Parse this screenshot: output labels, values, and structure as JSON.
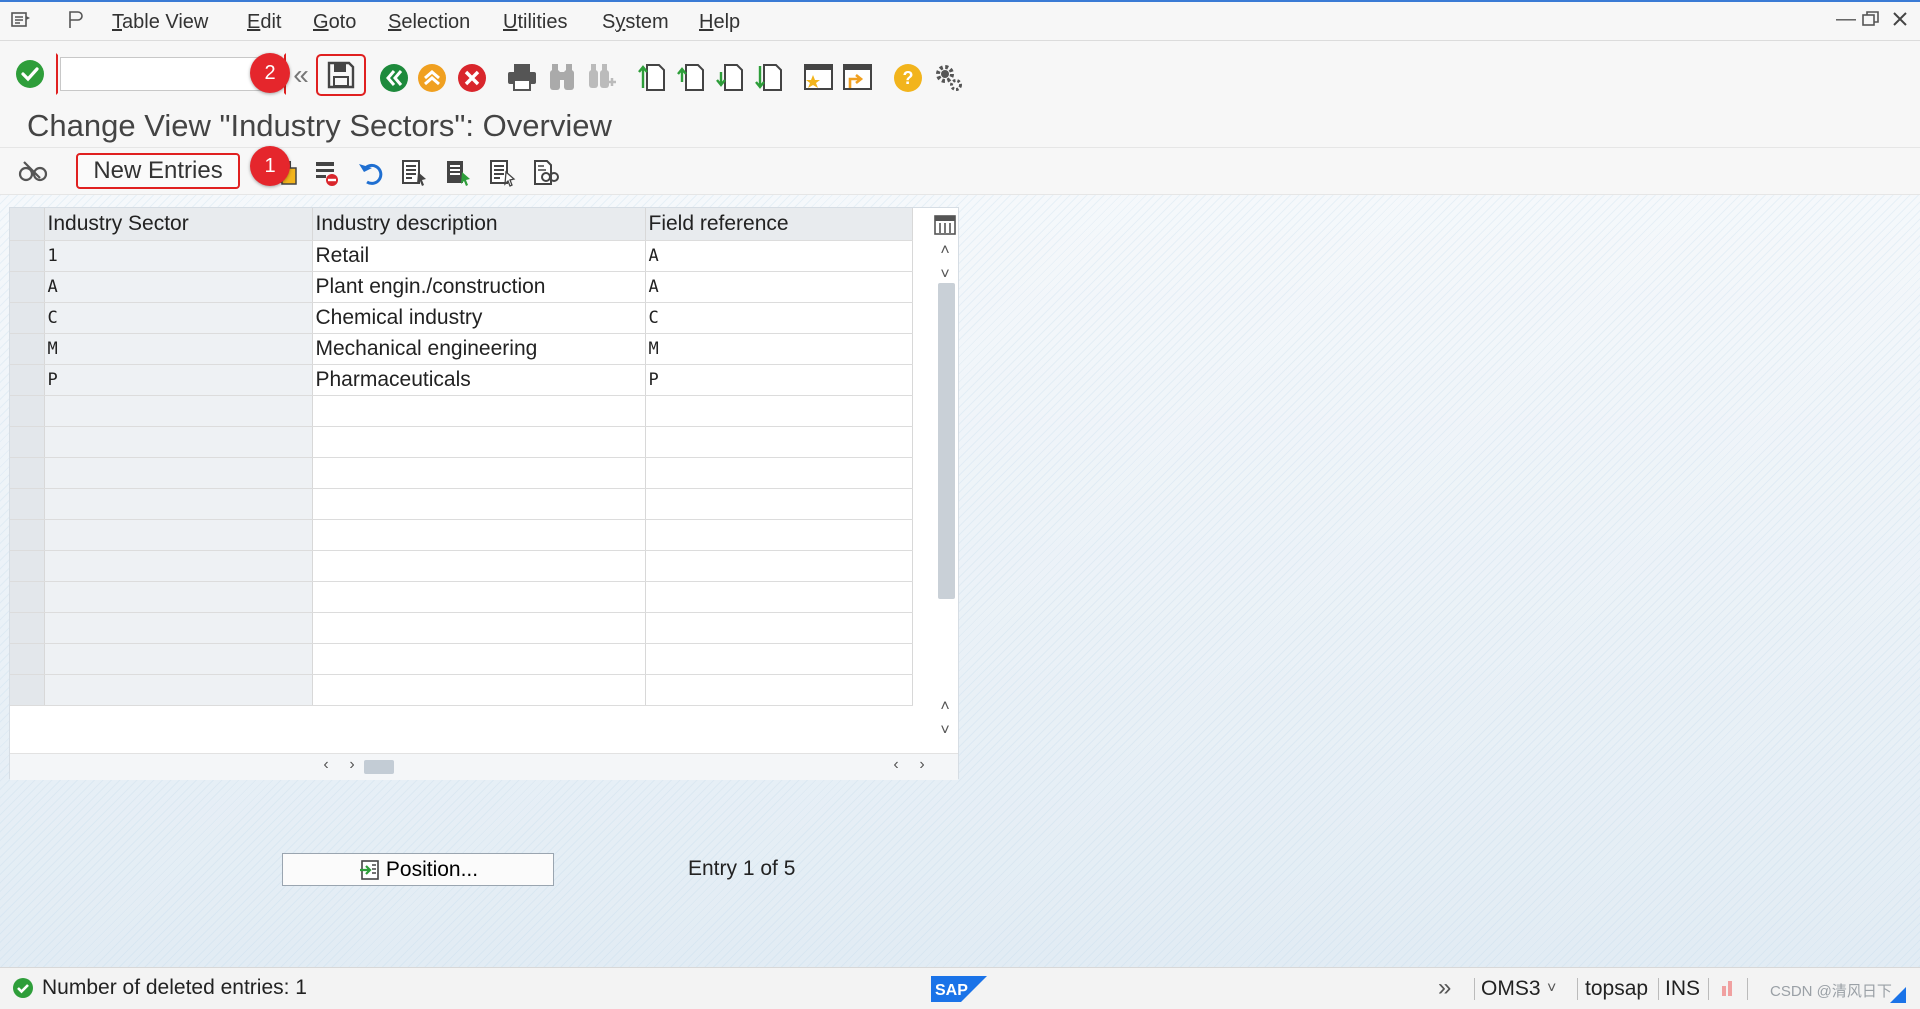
{
  "menubar": {
    "items": [
      {
        "label": "Table View",
        "u": "T"
      },
      {
        "label": "Edit",
        "u": "E"
      },
      {
        "label": "Goto",
        "u": "G"
      },
      {
        "label": "Selection",
        "u": "S"
      },
      {
        "label": "Utilities",
        "u": "U"
      },
      {
        "label": "System",
        "u": "y"
      },
      {
        "label": "Help",
        "u": "H"
      }
    ]
  },
  "toolbar": {
    "command_value": "",
    "save_marker": "2"
  },
  "page": {
    "title": "Change View \"Industry Sectors\": Overview"
  },
  "apptoolbar": {
    "new_entries_label": "New Entries",
    "new_entries_marker": "1"
  },
  "table": {
    "columns": [
      "Industry Sector",
      "Industry description",
      "Field reference"
    ],
    "rows": [
      [
        "1",
        "Retail",
        "A"
      ],
      [
        "A",
        "Plant engin./construction",
        "A"
      ],
      [
        "C",
        "Chemical industry",
        "C"
      ],
      [
        "M",
        "Mechanical engineering",
        "M"
      ],
      [
        "P",
        "Pharmaceuticals",
        "P"
      ],
      [
        "",
        "",
        ""
      ],
      [
        "",
        "",
        ""
      ],
      [
        "",
        "",
        ""
      ],
      [
        "",
        "",
        ""
      ],
      [
        "",
        "",
        ""
      ],
      [
        "",
        "",
        ""
      ],
      [
        "",
        "",
        ""
      ],
      [
        "",
        "",
        ""
      ],
      [
        "",
        "",
        ""
      ],
      [
        "",
        "",
        ""
      ]
    ]
  },
  "footer": {
    "position_label": "Position...",
    "entry_info": "Entry 1 of 5"
  },
  "statusbar": {
    "message": "Number of deleted entries: 1",
    "system": "OMS3",
    "client": "topsap",
    "mode": "INS",
    "logo": "SAP",
    "watermark": "CSDN @清风日下"
  },
  "colors": {
    "accent": "#3a7bd5",
    "highlight": "#e02020",
    "ok_green": "#2e9e3a",
    "back_green": "#1e8a3c",
    "exit_orange": "#f0a020",
    "cancel_red": "#d9262c",
    "help_yellow": "#f2b41c"
  }
}
